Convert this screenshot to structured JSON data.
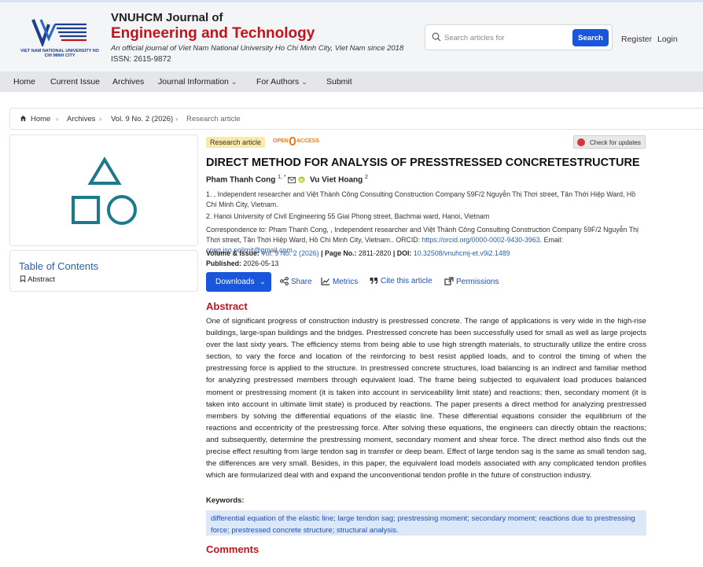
{
  "journal": {
    "logo_text": "VIET NAM NATIONAL UNIVERSITY HO CHI MINH CITY",
    "name_line1": "VNUHCM Journal of",
    "name_line2": "Engineering and Technology",
    "subtitle": "An official journal of Viet Nam National University Ho Chi Minh City, Viet Nam since 2018",
    "issn": "ISSN: 2615-9872"
  },
  "search": {
    "placeholder": "Search articles for",
    "button": "Search"
  },
  "header_links": {
    "register": "Register",
    "login": "Login"
  },
  "nav": {
    "home": "Home",
    "current_issue": "Current Issue",
    "archives": "Archives",
    "journal_info": "Journal Information",
    "for_authors": "For Authors",
    "submit": "Submit"
  },
  "breadcrumb": {
    "home": "Home",
    "archives": "Archives",
    "issue": "Vol. 9 No. 2 (2026)",
    "current": "Research article"
  },
  "sidebar": {
    "toc_title": "Table of Contents",
    "toc_items": [
      "Abstract"
    ]
  },
  "article": {
    "type_badge": "Research article",
    "open_access_left": "OPEN",
    "open_access_right": "ACCESS",
    "check_updates": "Check for updates",
    "title": "DIRECT METHOD FOR ANALYSIS OF PRESSTRESSED CONCRETESTRUCTURE",
    "authors": [
      {
        "name": "Pham Thanh Cong",
        "sup": "1, *"
      },
      {
        "name": "Vu Viet Hoang",
        "sup": "2"
      }
    ],
    "affiliations": [
      "1. , Independent researcher and Việt Thành Công Consulting Construction Company 59F/2 Nguyễn Thị Thơi street, Tân Thới Hiệp Ward, Hồ Chí Minh City, Vietnam.",
      "2. Hanoi University of Civil Engineering 55 Giai Phong street, Bachmai ward, Hanoi, Vietnam"
    ],
    "correspondence_label": "Correspondence to:",
    "correspondence_text": "Pham Thanh Cong, , Independent researcher and Việt Thành Công Consulting Construction Company 59F/2 Nguyễn Thị Thơi street, Tân Thới Hiệp Ward, Hồ Chí Minh City, Vietnam.. ORCID:",
    "orcid": "https://orcid.org/0000-0002-9430-3963",
    "email_label": ". Email:",
    "email": "cong.iso.nolimit@gmail.com",
    "email_end": ".",
    "volume_label": "Volume & Issue:",
    "volume_value": "Vol. 9 No. 2 (2026)",
    "pages_label": "| Page No.:",
    "pages_value": "2811-2820",
    "doi_label": "| DOI:",
    "doi_value": "10.32508/vnuhcmj-et.v9i2.1489",
    "published_label": "Published:",
    "published_value": "2026-05-13"
  },
  "actions": {
    "downloads": "Downloads",
    "share": "Share",
    "metrics": "Metrics",
    "cite": "Cite this article",
    "permissions": "Permissions"
  },
  "abstract": {
    "heading": "Abstract",
    "text": "One of significant progress of construction industry is prestressed concrete. The range of applications is very wide in the high-rise buildings, large-span buildings and the bridges. Prestressed concrete has been successfully used for small as well as large projects over the last sixty years. The efficiency stems from being able to use high strength materials, to structurally utilize the entire cross section, to vary the force and location of the reinforcing to best resist applied loads, and to control the timing of when the prestressing force is applied to the structure. In prestressed concrete structures, load balancing is an indirect and familiar method for analyzing prestressed members through equivalent load. The frame being subjected to equivalent load produces balanced moment or prestressing moment (it is taken into account in serviceability limit state) and reactions; then, secondary moment (it is taken into account in ultimate limit state) is produced by reactions. The paper presents a direct method for analyzing prestressed members by solving the differential equations of the elastic line. These differential equations consider the equilibrium of the reactions and eccentricity of the prestressing force. After solving these equations, the engineers can directly obtain the reactions; and subsequently, determine the prestressing moment, secondary moment and shear force. The direct method also finds out the precise effect resulting from large tendon sag in transfer or deep beam. Effect of large tendon sag is the same as small tendon sag, the differences are very small. Besides, in this paper, the equivalent load models associated with any complicated tendon profiles which are formularized deal with and expand the unconventional tendon profile in the future of construction industry."
  },
  "keywords": {
    "label": "Keywords:",
    "text": "differential equation of the elastic line; large tendon sag; prestressing moment; secondary moment; reactions due to prestressing force; prestressed concrete structure; structural analysis."
  },
  "comments": {
    "heading": "Comments"
  },
  "colors": {
    "brand_red": "#c0141c",
    "primary_blue": "#1a56db",
    "link_blue": "#2a5fa8",
    "teal_icon": "#1b7a8c"
  }
}
